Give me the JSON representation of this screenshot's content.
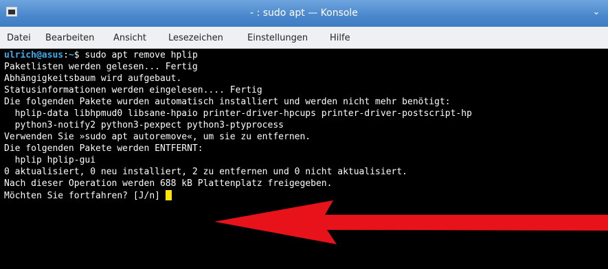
{
  "window": {
    "title": "- : sudo apt — Konsole"
  },
  "menu": {
    "items": [
      "Datei",
      "Bearbeiten",
      "Ansicht",
      "Lesezeichen",
      "Einstellungen",
      "Hilfe"
    ]
  },
  "terminal": {
    "prompt_user": "ulrich",
    "prompt_at": "@",
    "prompt_host": "asus",
    "prompt_sep": ":",
    "prompt_path": "~",
    "prompt_symbol": "$",
    "command": " sudo apt remove hplip",
    "output": [
      "Paketlisten werden gelesen... Fertig",
      "Abhängigkeitsbaum wird aufgebaut.",
      "Statusinformationen werden eingelesen.... Fertig",
      "Die folgenden Pakete wurden automatisch installiert und werden nicht mehr benötigt:",
      "  hplip-data libhpmud0 libsane-hpaio printer-driver-hpcups printer-driver-postscript-hp",
      "  python3-notify2 python3-pexpect python3-ptyprocess",
      "Verwenden Sie »sudo apt autoremove«, um sie zu entfernen.",
      "Die folgenden Pakete werden ENTFERNT:",
      "  hplip hplip-gui",
      "0 aktualisiert, 0 neu installiert, 2 zu entfernen und 0 nicht aktualisiert.",
      "Nach dieser Operation werden 688 kB Plattenplatz freigegeben."
    ],
    "question": "Möchten Sie fortfahren? [J/n]"
  },
  "annotation": {
    "arrow_color": "#e8121b"
  },
  "colors": {
    "prompt": "#3daee9",
    "cursor": "#ffe600",
    "titlebar": "#4a87cc"
  }
}
